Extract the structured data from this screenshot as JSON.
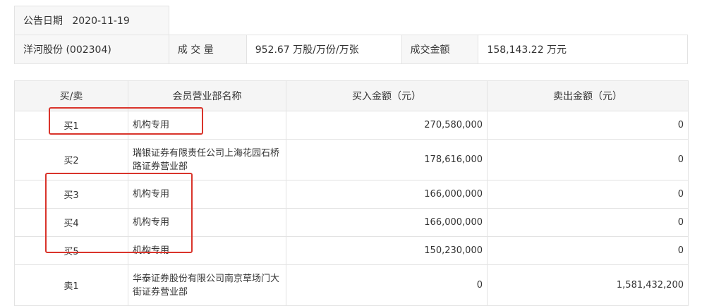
{
  "info": {
    "date_label": "公告日期",
    "date_value": "2020-11-19",
    "stock": "洋河股份 (002304)",
    "volume_label": "成 交 量",
    "volume_value": "952.67 万股/万份/万张",
    "amount_label": "成交金额",
    "amount_value": "158,143.22 万元"
  },
  "table": {
    "headers": [
      "买/卖",
      "会员营业部名称",
      "买入金额（元）",
      "卖出金额（元）"
    ],
    "rows": [
      {
        "side": "买1",
        "name": "机构专用",
        "buy": "270,580,000",
        "sell": "0"
      },
      {
        "side": "买2",
        "name": "瑞银证券有限责任公司上海花园石桥路证券营业部",
        "buy": "178,616,000",
        "sell": "0"
      },
      {
        "side": "买3",
        "name": "机构专用",
        "buy": "166,000,000",
        "sell": "0"
      },
      {
        "side": "买4",
        "name": "机构专用",
        "buy": "166,000,000",
        "sell": "0"
      },
      {
        "side": "买5",
        "name": "机构专用",
        "buy": "150,230,000",
        "sell": "0"
      },
      {
        "side": "卖1",
        "name": "华泰证券股份有限公司南京草场门大街证券营业部",
        "buy": "0",
        "sell": "1,581,432,200"
      }
    ]
  },
  "colors": {
    "highlight": "#d9342b",
    "header_bg": "#f5f5f5",
    "border": "#e3e3e3"
  }
}
